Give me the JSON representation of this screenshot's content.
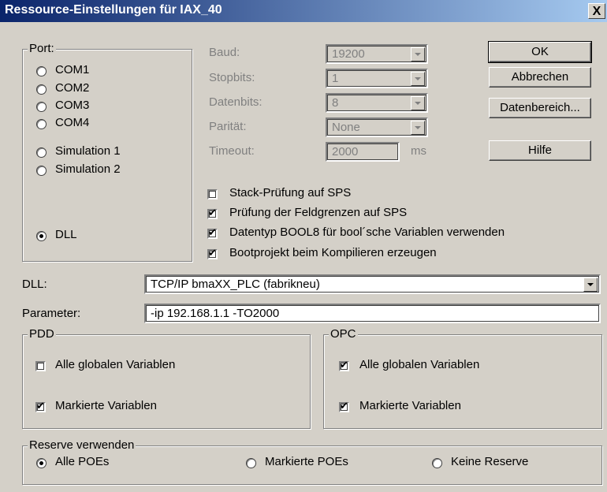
{
  "window": {
    "title": "Ressource-Einstellungen für IAX_40",
    "close_label": "X"
  },
  "port": {
    "legend": "Port:",
    "options": [
      "COM1",
      "COM2",
      "COM3",
      "COM4",
      "Simulation 1",
      "Simulation 2",
      "DLL"
    ],
    "selected": "DLL"
  },
  "serial": {
    "baud_label": "Baud:",
    "baud_value": "19200",
    "stopbits_label": "Stopbits:",
    "stopbits_value": "1",
    "databits_label": "Datenbits:",
    "databits_value": "8",
    "parity_label": "Parität:",
    "parity_value": "None",
    "timeout_label": "Timeout:",
    "timeout_value": "2000",
    "timeout_unit": "ms"
  },
  "buttons": {
    "ok": "OK",
    "cancel": "Abbrechen",
    "datarange": "Datenbereich...",
    "help": "Hilfe"
  },
  "options": [
    {
      "label": "Stack-Prüfung auf SPS",
      "checked": false
    },
    {
      "label": "Prüfung der Feldgrenzen auf SPS",
      "checked": true
    },
    {
      "label": "Datentyp BOOL8 für bool´sche Variablen verwenden",
      "checked": true
    },
    {
      "label": "Bootprojekt beim Kompilieren erzeugen",
      "checked": true
    }
  ],
  "dll": {
    "label": "DLL:",
    "value": "TCP/IP bmaXX_PLC (fabrikneu)"
  },
  "parameter": {
    "label": "Parameter:",
    "value": "-ip 192.168.1.1 -TO2000"
  },
  "pdd": {
    "legend": "PDD",
    "all_label": "Alle globalen Variablen",
    "all_checked": false,
    "marked_label": "Markierte Variablen",
    "marked_checked": true
  },
  "opc": {
    "legend": "OPC",
    "all_label": "Alle globalen Variablen",
    "all_checked": true,
    "marked_label": "Markierte Variablen",
    "marked_checked": true
  },
  "reserve": {
    "legend": "Reserve verwenden",
    "options": [
      "Alle POEs",
      "Markierte POEs",
      "Keine Reserve"
    ],
    "selected": "Alle POEs"
  }
}
